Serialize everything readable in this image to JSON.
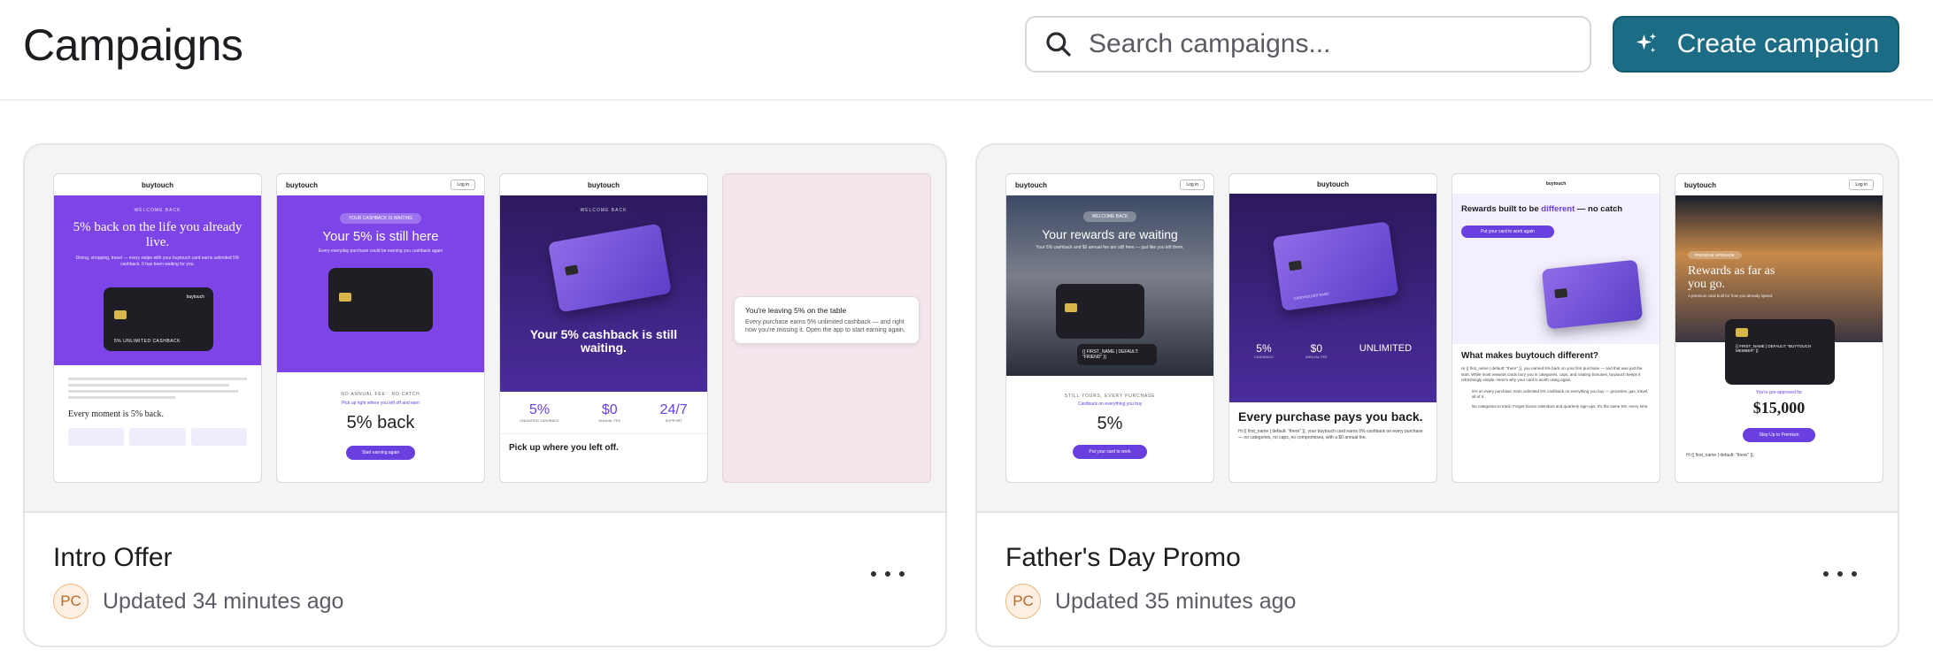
{
  "header": {
    "title": "Campaigns",
    "search_placeholder": "Search campaigns...",
    "create_label": "Create campaign"
  },
  "campaigns": [
    {
      "name": "Intro Offer",
      "owner_initials": "PC",
      "updated": "Updated 34 minutes ago",
      "thumbs": {
        "t1": {
          "brand": "buytouch",
          "eyebrow": "WELCOME BACK",
          "headline": "5% back on the life you already live.",
          "body": "Dining, shopping, travel — every swipe with your buytouch card earns unlimited 5% cashback. It has been waiting for you.",
          "section": "Every moment is 5% back.",
          "card_caption": "5% UNLIMITED CASHBACK"
        },
        "t2": {
          "brand": "buytouch",
          "login": "Log in",
          "badge": "YOUR CASHBACK IS WAITING",
          "headline": "Your 5% is still here",
          "sub": "Every everyday purchase could be earning you cashback again",
          "eyebrow2": "NO ANNUAL FEE · NO CATCH",
          "link": "Pick up right where you left off and earn",
          "big": "5% back",
          "cta": "Start earning again"
        },
        "t3": {
          "brand": "buytouch",
          "eyebrow": "WELCOME BACK",
          "headline": "Your 5% cashback is still waiting.",
          "stats": [
            {
              "value": "5%",
              "label": "UNLIMITED CASHBACK"
            },
            {
              "value": "$0",
              "label": "ANNUAL FEE"
            },
            {
              "value": "24/7",
              "label": "SUPPORT"
            }
          ],
          "footer": "Pick up where you left off."
        },
        "t4": {
          "title": "You're leaving 5% on the table",
          "body": "Every purchase earns 5% unlimited cashback — and right now you're missing it. Open the app to start earning again."
        }
      }
    },
    {
      "name": "Father's Day Promo",
      "owner_initials": "PC",
      "updated": "Updated 35 minutes ago",
      "thumbs": {
        "t1": {
          "brand": "buytouch",
          "login": "Log in",
          "badge": "WELCOME BACK",
          "headline": "Your rewards are waiting",
          "sub": "Your 5% cashback and $0 annual fee are still here — just like you left them.",
          "card_name": "{{ FIRST_NAME | DEFAULT: \"FRIEND\" }}",
          "eyebrow2": "STILL YOURS, EVERY PURCHASE",
          "link": "Cashback on everything you buy",
          "big": "5%",
          "cta": "Put your card to work"
        },
        "t2": {
          "brand": "buytouch",
          "card_holder": "CARDHOLDER NAME",
          "stats": [
            {
              "value": "5%",
              "label": "CASHBACK"
            },
            {
              "value": "$0",
              "label": "ANNUAL FEE"
            },
            {
              "value": "UNLIMITED",
              "label": ""
            }
          ],
          "headline": "Every purchase pays you back.",
          "body": "Hi {{ first_name | default: \"there\" }}, your buytouch card earns 5% cashback on every purchase — no categories, no caps, no compromises, with a $0 annual fee."
        },
        "t3": {
          "brand": "buytouch",
          "headline_pre": "Rewards built to be",
          "headline_accent": "different",
          "headline_post": "— no catch",
          "cta": "Put your card to work again",
          "section": "What makes buytouch different?",
          "body": "Hi {{ first_name | default: \"there\" }}, you earned 5% back on your first purchase — and that was just the start. While most rewards cards bury you in categories, caps, and rotating bonuses, buytouch keeps it refreshingly simple. Here's why your card is worth using again.",
          "bullet1": "5% on every purchase: Earn unlimited 5% cashback on everything you buy — groceries, gas, travel, all of it.",
          "bullet2": "No categories to track: Forget bonus calendars and quarterly sign-ups. It's the same 5%, every time."
        },
        "t4": {
          "brand": "buytouch",
          "login": "Log in",
          "badge": "PREMIUM UPGRADE",
          "headline": "Rewards as far as you go.",
          "sub": "A premium card built for how you already spend.",
          "card_name": "{{ FIRST_NAME | DEFAULT: \"BUYTOUCH MEMBER\" }}",
          "approved": "You're pre-approved for",
          "amount": "$15,000",
          "cta": "Step Up to Premium",
          "greeting": "Hi {{ first_name | default: \"there\" }},"
        }
      }
    }
  ],
  "colors": {
    "accent": "#1b6c84",
    "brand_purple": "#7d45e8",
    "avatar_bg": "#fdf0e3"
  },
  "icons": {
    "search": "search-icon",
    "create": "sparkle-icon",
    "more": "more-horizontal-icon"
  }
}
